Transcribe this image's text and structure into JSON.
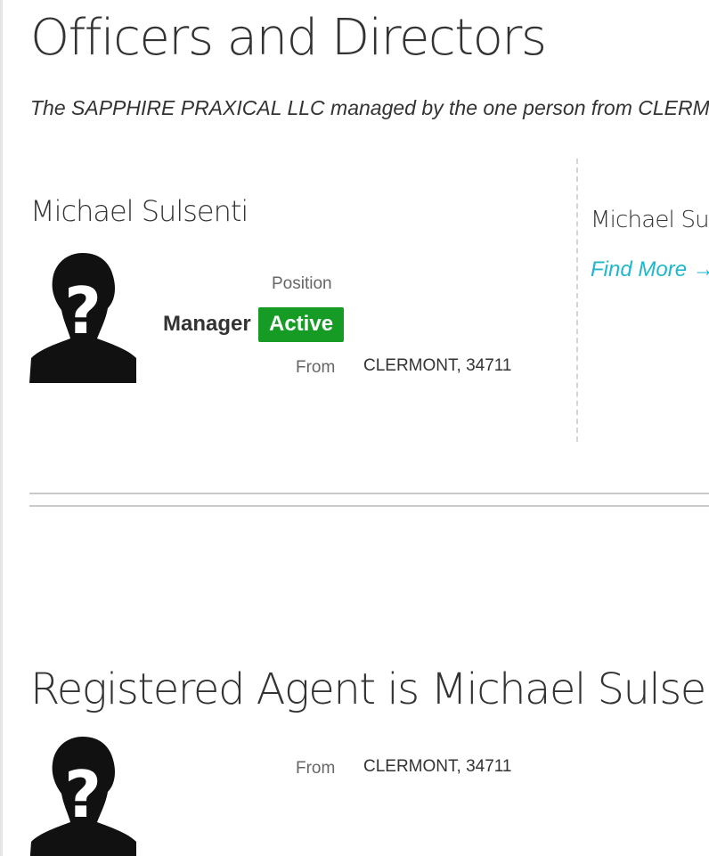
{
  "officers": {
    "title": "Officers and Directors",
    "subtitle": "The SAPPHIRE PRAXICAL LLC managed by the one person from CLERMONT",
    "person": {
      "name": "Michael Sulsenti",
      "position_label": "Position",
      "role": "Manager",
      "status": "Active",
      "from_label": "From",
      "from_value": "CLERMONT, 34711",
      "avatar_icon": "unknown-person-icon"
    },
    "sidebar": {
      "name": "Michael Sulsenti",
      "link_label": "Find More →"
    }
  },
  "agent": {
    "title": "Registered Agent is Michael Sulsenti",
    "from_label": "From",
    "from_value": "CLERMONT, 34711",
    "avatar_icon": "unknown-person-icon"
  },
  "colors": {
    "status_active": "#169c24",
    "link": "#1fb7c9"
  }
}
